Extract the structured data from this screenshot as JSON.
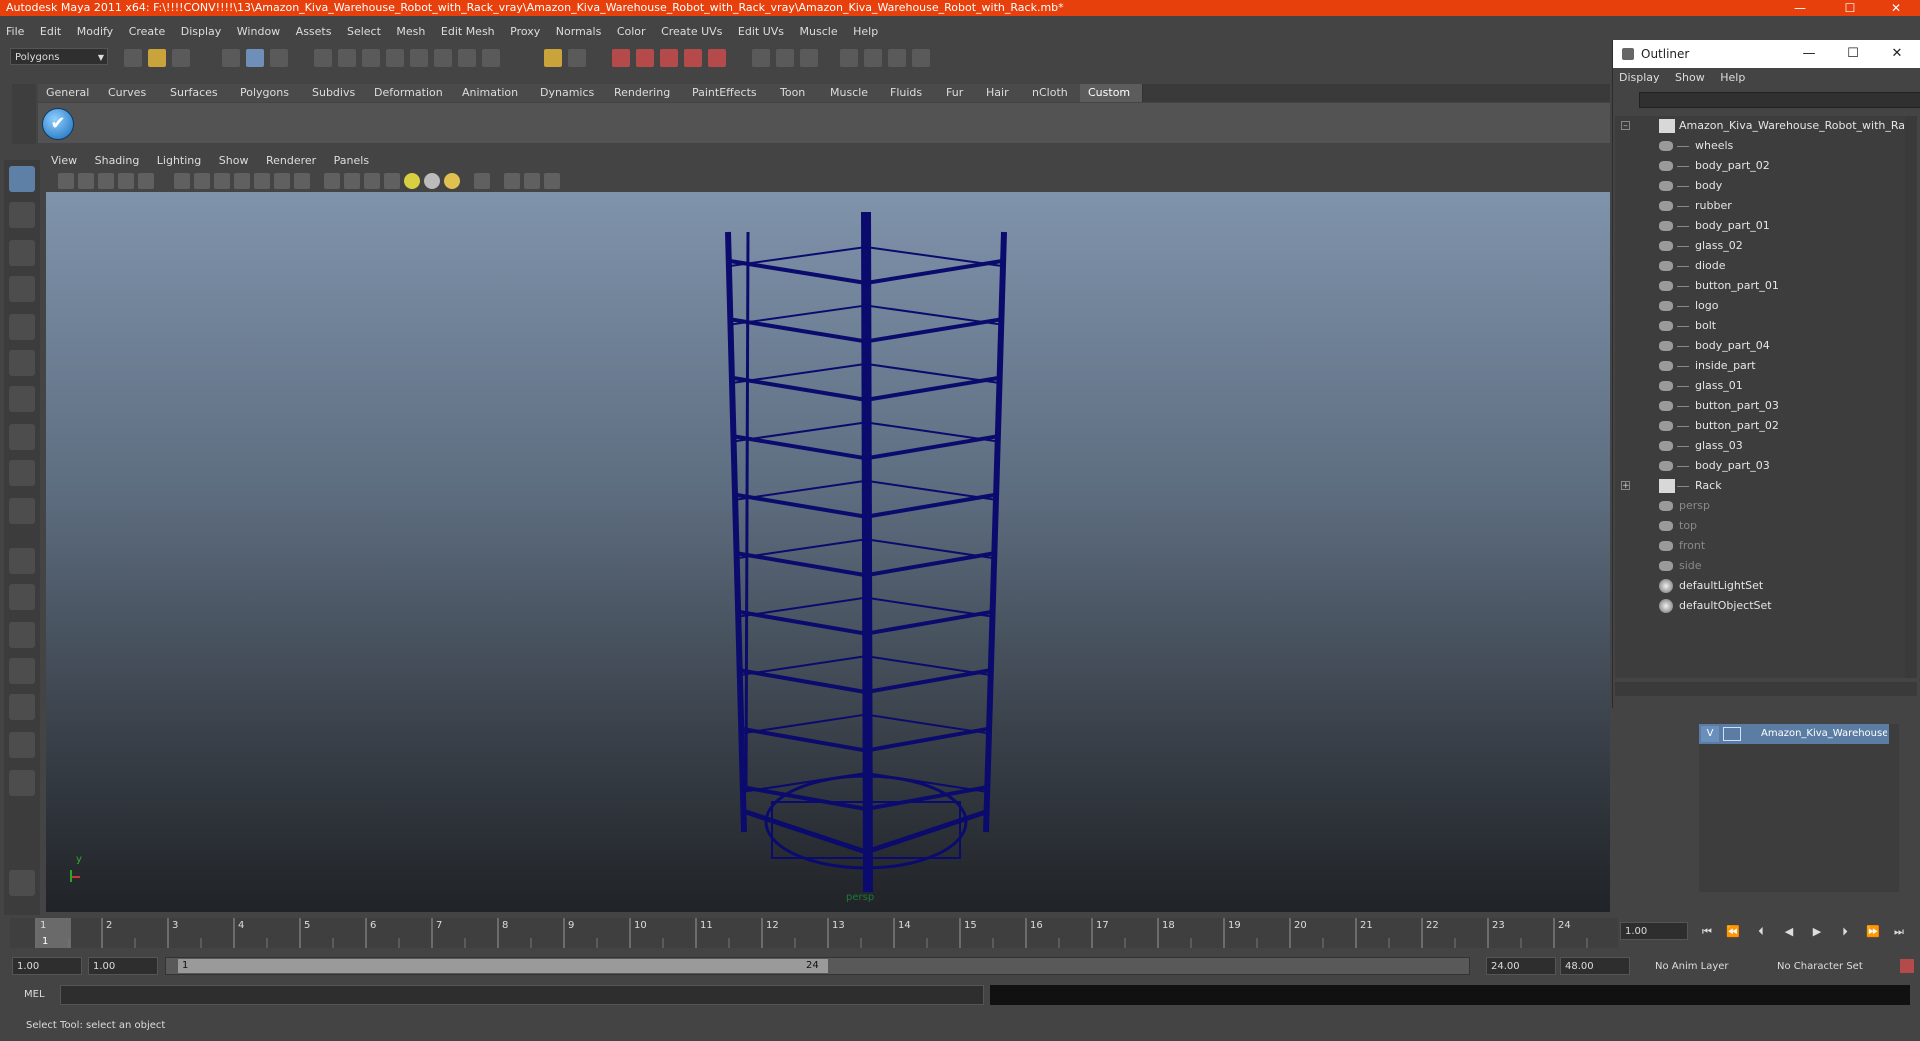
{
  "window": {
    "title": "Autodesk Maya 2011 x64: F:\\!!!!CONV!!!!\\13\\Amazon_Kiva_Warehouse_Robot_with_Rack_vray\\Amazon_Kiva_Warehouse_Robot_with_Rack_vray\\Amazon_Kiva_Warehouse_Robot_with_Rack.mb*",
    "minimize": "—",
    "maximize": "☐",
    "close": "✕"
  },
  "menubar": [
    "File",
    "Edit",
    "Modify",
    "Create",
    "Display",
    "Window",
    "Assets",
    "Select",
    "Mesh",
    "Edit Mesh",
    "Proxy",
    "Normals",
    "Color",
    "Create UVs",
    "Edit UVs",
    "Muscle",
    "Help"
  ],
  "toolbar": {
    "mode_select": "Polygons"
  },
  "shelf": {
    "tabs": [
      "General",
      "Curves",
      "Surfaces",
      "Polygons",
      "Subdivs",
      "Deformation",
      "Animation",
      "Dynamics",
      "Rendering",
      "PaintEffects",
      "Toon",
      "Muscle",
      "Fluids",
      "Fur",
      "Hair",
      "nCloth",
      "Custom"
    ],
    "active_tab": "Custom"
  },
  "viewport": {
    "menu": [
      "View",
      "Shading",
      "Lighting",
      "Show",
      "Renderer",
      "Panels"
    ],
    "camera_label": "persp",
    "axis_y": "y",
    "axis_x": "x",
    "wire_color": "#0b0b6e"
  },
  "outliner": {
    "title": "Outliner",
    "menu": [
      "Display",
      "Show",
      "Help"
    ],
    "root": "Amazon_Kiva_Warehouse_Robot_with_Rack",
    "children": [
      "wheels",
      "body_part_02",
      "body",
      "rubber",
      "body_part_01",
      "glass_02",
      "diode",
      "button_part_01",
      "logo",
      "bolt",
      "body_part_04",
      "inside_part",
      "glass_01",
      "button_part_03",
      "button_part_02",
      "glass_03",
      "body_part_03"
    ],
    "rack": "Rack",
    "cameras": [
      "persp",
      "top",
      "front",
      "side"
    ],
    "sets": [
      "defaultLightSet",
      "defaultObjectSet"
    ]
  },
  "layers": {
    "visible_flag": "V",
    "layer_name": "Amazon_Kiva_Warehouse_Robot_with_Rack"
  },
  "timeline": {
    "ticks": [
      "1",
      "2",
      "3",
      "4",
      "5",
      "6",
      "7",
      "8",
      "9",
      "10",
      "11",
      "12",
      "13",
      "14",
      "15",
      "16",
      "17",
      "18",
      "19",
      "20",
      "21",
      "22",
      "23",
      "24"
    ],
    "current_marker": "1",
    "current_frame": "1.00"
  },
  "range": {
    "start": "1.00",
    "playback_start": "1.00",
    "slider_start": "1",
    "slider_end": "24",
    "playback_end": "24.00",
    "end": "48.00",
    "anim_layer": "No Anim Layer",
    "character_set": "No Character Set"
  },
  "command": {
    "lang": "MEL"
  },
  "help_line": "Select Tool: select an object"
}
